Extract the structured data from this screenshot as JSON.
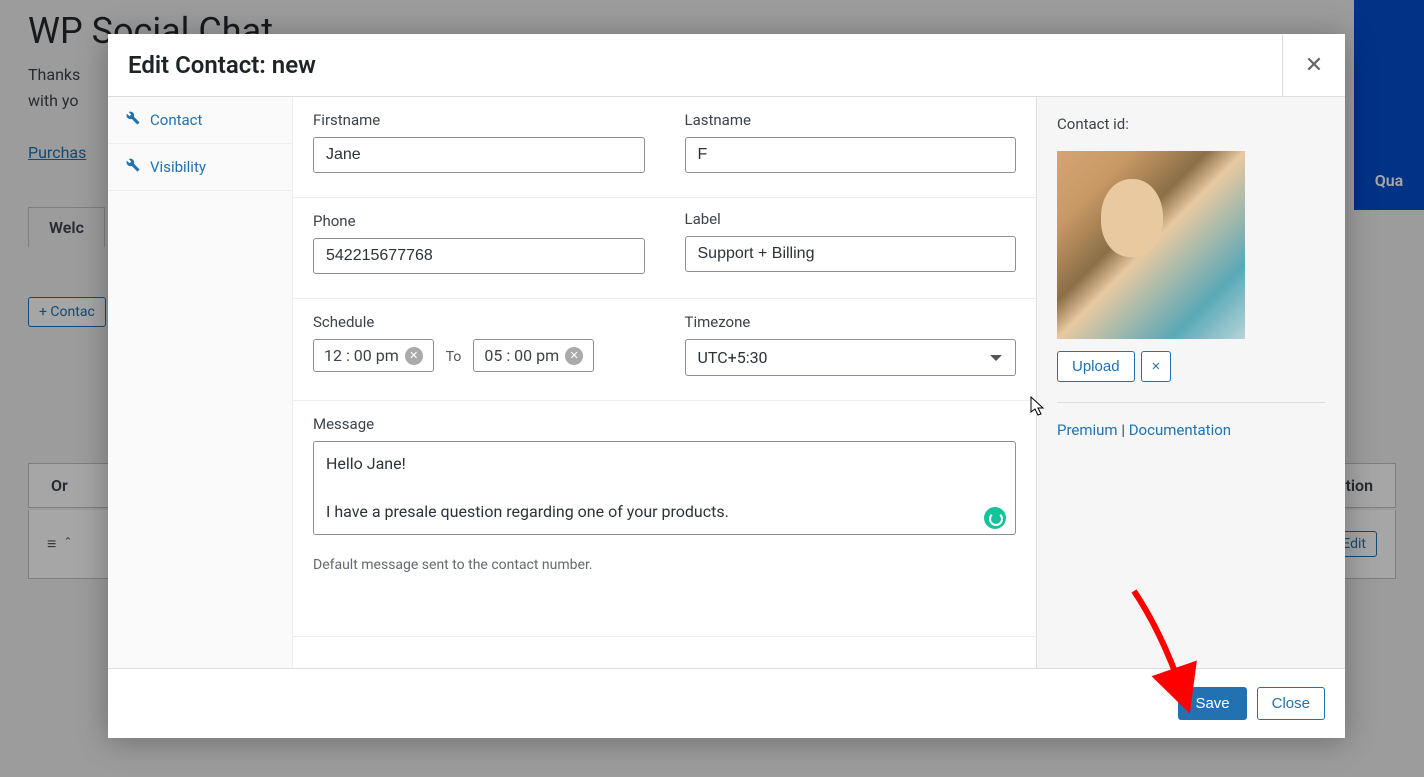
{
  "background": {
    "page_title": "WP Social Chat",
    "thanks_line1": "Thanks",
    "thanks_line2": "with yo",
    "purchase_link": "Purchas",
    "tab_welcome": "Welc",
    "add_contact_btn": "+ Contac",
    "table_header_order": "Or",
    "table_header_action": "Action",
    "edit_btn": "Edit",
    "blue_label": "Qua"
  },
  "modal": {
    "title": "Edit Contact: new"
  },
  "sidebar": {
    "contact": "Contact",
    "visibility": "Visibility"
  },
  "form": {
    "firstname_label": "Firstname",
    "firstname_value": "Jane",
    "lastname_label": "Lastname",
    "lastname_value": "F",
    "phone_label": "Phone",
    "phone_value": "542215677768",
    "label_label": "Label",
    "label_value": "Support + Billing",
    "schedule_label": "Schedule",
    "schedule_from": "12 : 00   pm",
    "schedule_to_label": "To",
    "schedule_to": "05 : 00   pm",
    "timezone_label": "Timezone",
    "timezone_value": "UTC+5:30",
    "message_label": "Message",
    "message_value": "Hello Jane!\n\nI have a presale question regarding one of your products.",
    "message_help": "Default message sent to the contact number."
  },
  "aside": {
    "contact_id_label": "Contact id:",
    "upload_btn": "Upload",
    "remove_btn": "×",
    "premium_link": "Premium",
    "divider": " | ",
    "docs_link": "Documentation"
  },
  "footer": {
    "save": "Save",
    "close": "Close"
  }
}
